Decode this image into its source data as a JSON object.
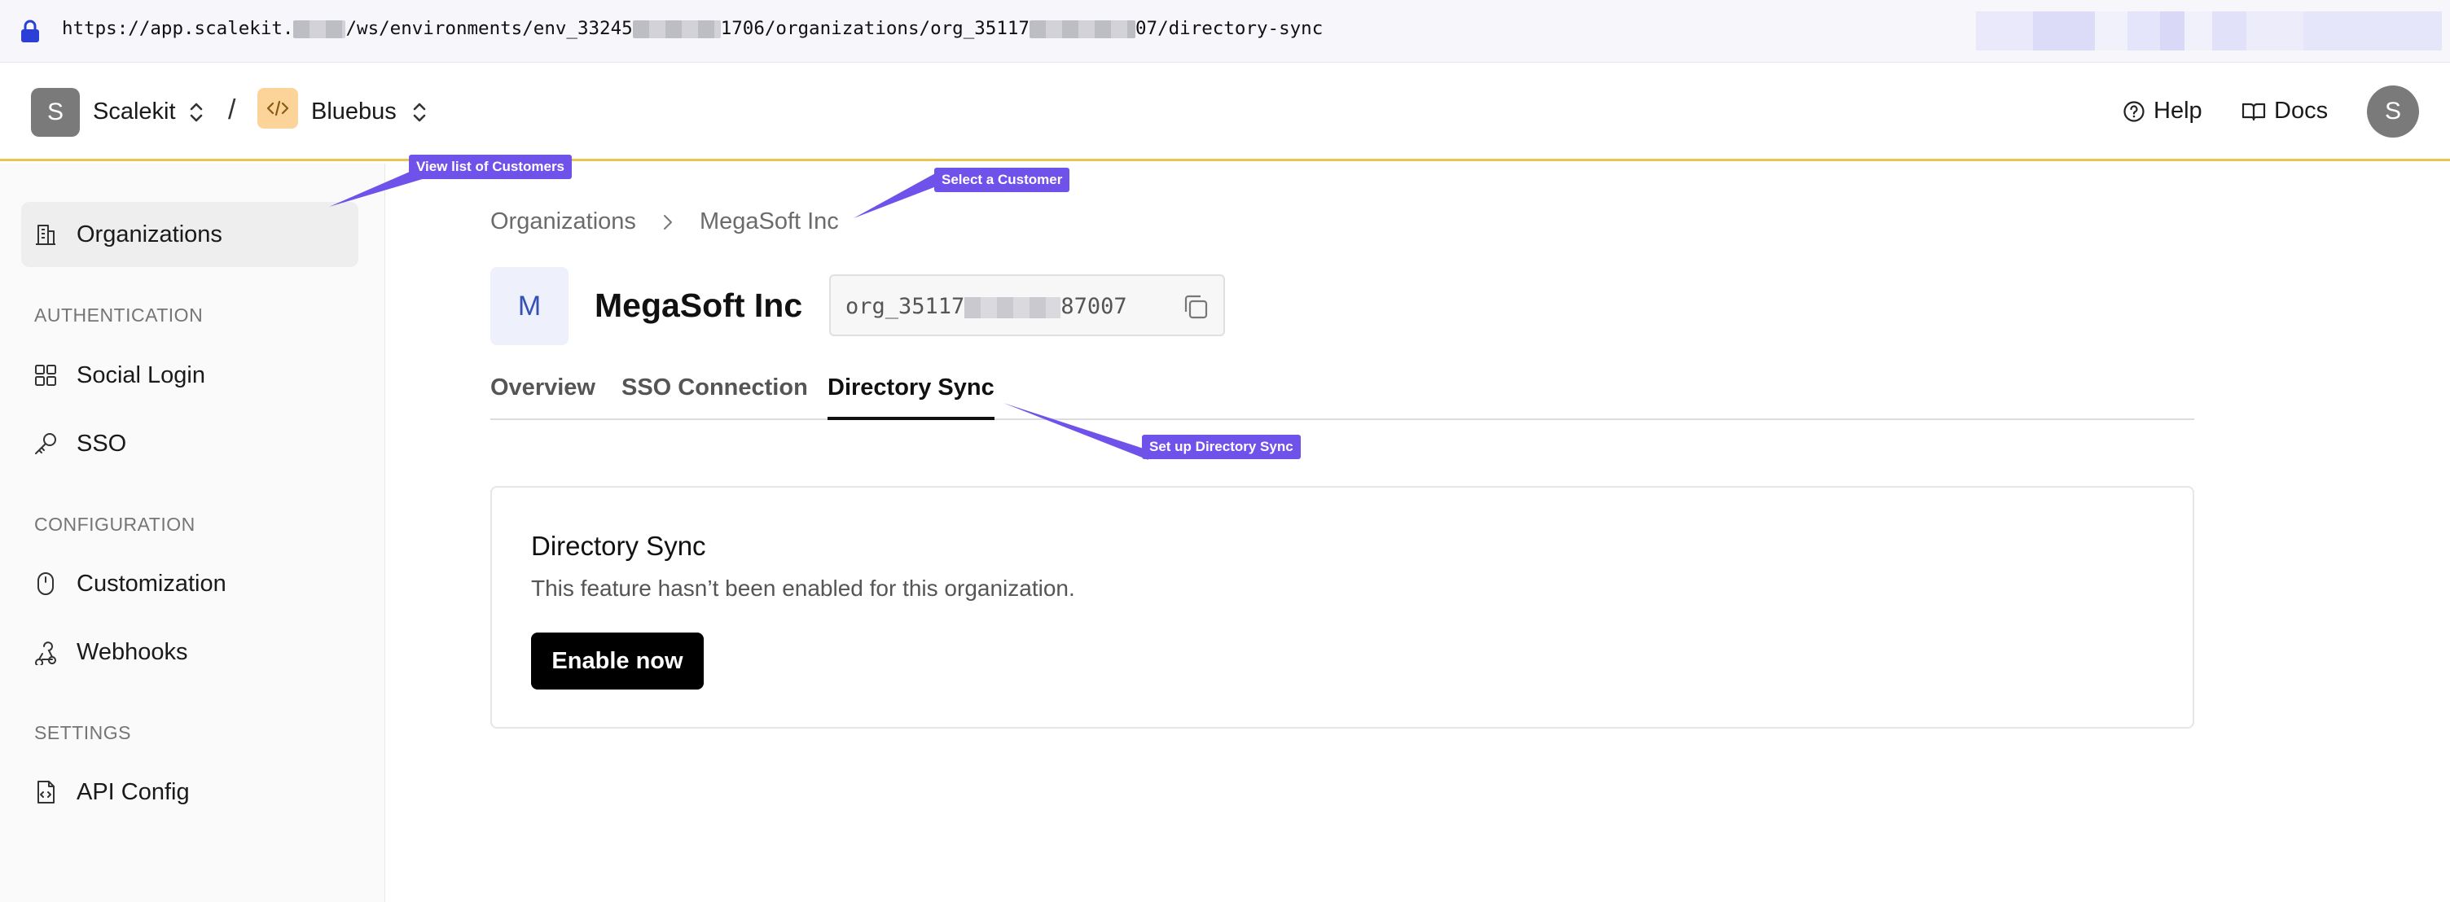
{
  "browser": {
    "url_part1": "https://app.scalekit.",
    "url_part2": "/ws/environments/env_33245",
    "url_part3": "1706/organizations/org_35117",
    "url_part4": "07/directory-sync"
  },
  "topnav": {
    "workspace_initial": "S",
    "workspace_name": "Scalekit",
    "separator": "/",
    "environment_name": "Bluebus",
    "help_label": "Help",
    "docs_label": "Docs",
    "user_initial": "S"
  },
  "sidebar": {
    "organizations": "Organizations",
    "section_auth": "AUTHENTICATION",
    "social_login": "Social Login",
    "sso": "SSO",
    "section_config": "CONFIGURATION",
    "customization": "Customization",
    "webhooks": "Webhooks",
    "section_settings": "SETTINGS",
    "api_config": "API Config"
  },
  "breadcrumb": {
    "root": "Organizations",
    "current": "MegaSoft Inc"
  },
  "org": {
    "initial": "M",
    "name": "MegaSoft Inc",
    "id_prefix": "org_35117",
    "id_suffix": "87007"
  },
  "tabs": {
    "overview": "Overview",
    "sso_connection": "SSO Connection",
    "directory_sync": "Directory Sync"
  },
  "card": {
    "title": "Directory Sync",
    "description": "This feature hasn’t been enabled for this organization.",
    "button": "Enable now"
  },
  "callouts": {
    "customers": "View list of Customers",
    "select_customer": "Select a Customer",
    "setup_sync": "Set up Directory Sync"
  },
  "colors": {
    "accent_callout": "#6f52ea",
    "nav_border": "#eac451",
    "primary_button": "#000000"
  }
}
